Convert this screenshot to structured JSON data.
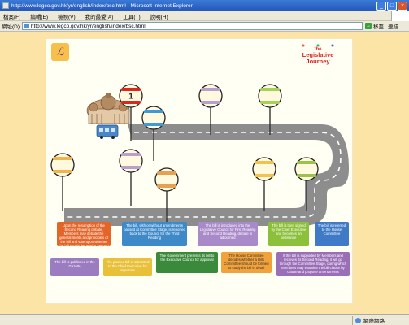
{
  "window": {
    "title": "http://www.legco.gov.hk/yr/english/index/bsc.html - Microsoft Internet Explorer",
    "controls": [
      "_",
      "□",
      "×"
    ]
  },
  "menubar": {
    "items": [
      "檔案(F)",
      "編輯(E)",
      "檢視(V)",
      "我的最愛(A)",
      "工具(T)",
      "說明(H)"
    ]
  },
  "addressbar": {
    "label": "網址(D)",
    "url": "http://www.legco.gov.hk/yr/english/index/bsc.html",
    "go_label": "移至",
    "links_label": "連結"
  },
  "page": {
    "logo_left_glyph": "ℒ",
    "journey_logo": {
      "the": "the",
      "line1": "Legislative",
      "line2": "Journey"
    },
    "stop_number": "1",
    "stops": [
      {
        "color": "#d9291c"
      },
      {
        "color": "#3a9bd6"
      },
      {
        "color": "#b9a0cc"
      },
      {
        "color": "#a7d15a"
      },
      {
        "color": "#f2b44a"
      },
      {
        "color": "#b9a0cc"
      },
      {
        "color": "#e6a050"
      },
      {
        "color": "#f2c24a"
      },
      {
        "color": "#9ac34a"
      },
      {
        "color": "#e87070"
      },
      {
        "color": "#5aaad6"
      },
      {
        "color": "#9a88c8"
      }
    ],
    "info_boxes": [
      {
        "text": "Upon the resumption of the Second Reading debate, Members may debate the general merits and principles of the bill and vote upon whether the bill should be read a Second time"
      },
      {
        "text": "The bill, with or without amendments passed at Committee Stage, is reported back to the Council for the Third Reading"
      },
      {
        "text": "The bill is introduced into the Legislative Council for First Reading and Second Reading, debate is adjourned"
      },
      {
        "text": "The bill is then signed by the Chief Executive and becomes an ordinance"
      },
      {
        "text": "The bill is referred to the House Committee"
      },
      {
        "text": "The bill is published in the Gazette"
      },
      {
        "text": "The passed bill is submitted to the Chief Executive for signature"
      },
      {
        "text": "The Government presents its bill to the Executive Council for approval"
      },
      {
        "text": "The House Committee decides whether a Bills Committee should be formed to study the bill in detail"
      },
      {
        "text": "If the bill is supported by Members and receives its Second Reading, it will go through the Committee Stage, during which Members may examine the bill clause by clause and propose amendments"
      }
    ]
  },
  "statusbar": {
    "text": "",
    "zone": "網際網路"
  },
  "colors": {
    "page_bg": "#fce3a6",
    "road": "#8d8d8d",
    "stage_bg": "#fffff4"
  }
}
